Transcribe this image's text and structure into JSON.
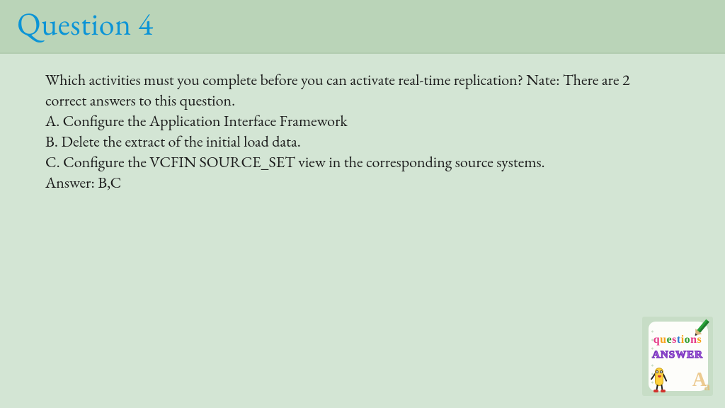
{
  "header": {
    "title": "Question 4"
  },
  "body": {
    "prompt": "Which activities must you complete before you can activate real-time replication? Nate: There are 2 correct answers to this question.",
    "options": {
      "A": "A. Configure the Application Interface Framework",
      "B": "B. Delete the extract of the initial load data.",
      "C": "C. Configure the VCFIN SOURCE_SET view in the corresponding source systems."
    },
    "answer_line": "Answer: B,C"
  },
  "badge": {
    "word_questions": "questions",
    "word_answer": "ANSWER",
    "glyph_A": "A",
    "glyph_a": "a"
  }
}
